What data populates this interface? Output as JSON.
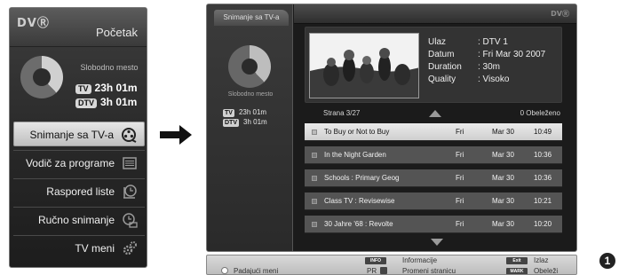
{
  "menu": {
    "logo": "DVⓇ",
    "title": "Početak",
    "free_space_label": "Slobodno mesto",
    "tv_tag": "TV",
    "tv_time": "23h 01m",
    "dtv_tag": "DTV",
    "dtv_time": "3h 01m",
    "items": [
      {
        "label": "Snimanje sa TV-a",
        "icon": "film-reel-icon",
        "selected": true
      },
      {
        "label": "Vodič za programe",
        "icon": "program-guide-icon",
        "selected": false
      },
      {
        "label": "Raspored liste",
        "icon": "clock-icon",
        "selected": false
      },
      {
        "label": "Ručno snimanje",
        "icon": "manual-record-icon",
        "selected": false
      },
      {
        "label": "TV meni",
        "icon": "gears-icon",
        "selected": false
      }
    ]
  },
  "screen": {
    "tab_label": "Snimanje sa TV-a",
    "logo": "DVⓇ",
    "free_space_label": "Slobodno mesto",
    "tv_tag": "TV",
    "tv_time": "23h 01m",
    "dtv_tag": "DTV",
    "dtv_time": "3h 01m",
    "info": {
      "labels": [
        "Ulaz",
        "Datum",
        "Duration",
        "Quality"
      ],
      "values": [
        ": DTV 1",
        ": Fri Mar 30 2007",
        ": 30m",
        ": Visoko"
      ]
    },
    "list_header": {
      "page": "Strana   3/27",
      "marked": "0 Obeleženo"
    },
    "rows": [
      {
        "title": "To Buy or Not to Buy",
        "day": "Fri",
        "date": "Mar 30",
        "time": "10:49",
        "selected": true
      },
      {
        "title": "In the Night Garden",
        "day": "Fri",
        "date": "Mar 30",
        "time": "10:36",
        "selected": false
      },
      {
        "title": "Schools : Primary Geog",
        "day": "Fri",
        "date": "Mar 30",
        "time": "10:36",
        "selected": false
      },
      {
        "title": "Class TV : Revisewise",
        "day": "Fri",
        "date": "Mar 30",
        "time": "10:21",
        "selected": false
      },
      {
        "title": "30 Jahre '68 : Revolte",
        "day": "Fri",
        "date": "Mar 30",
        "time": "10:20",
        "selected": false
      }
    ]
  },
  "legend": {
    "popup_menu": "Padajući meni",
    "info_key": "INFO",
    "info_text": "Informacije",
    "pr_key": "PR",
    "pr_text": "Promeni stranicu",
    "exit_key": "Exit",
    "exit_text": "Izlaz",
    "mark_key": "MARK",
    "mark_text": "Obeleži"
  },
  "figure_number": "1",
  "colors": {
    "menu_bg": "#262626",
    "selected_bg": "#d9d9d9",
    "row_bg": "#545454",
    "screen_bg": "#1b1b1b"
  }
}
